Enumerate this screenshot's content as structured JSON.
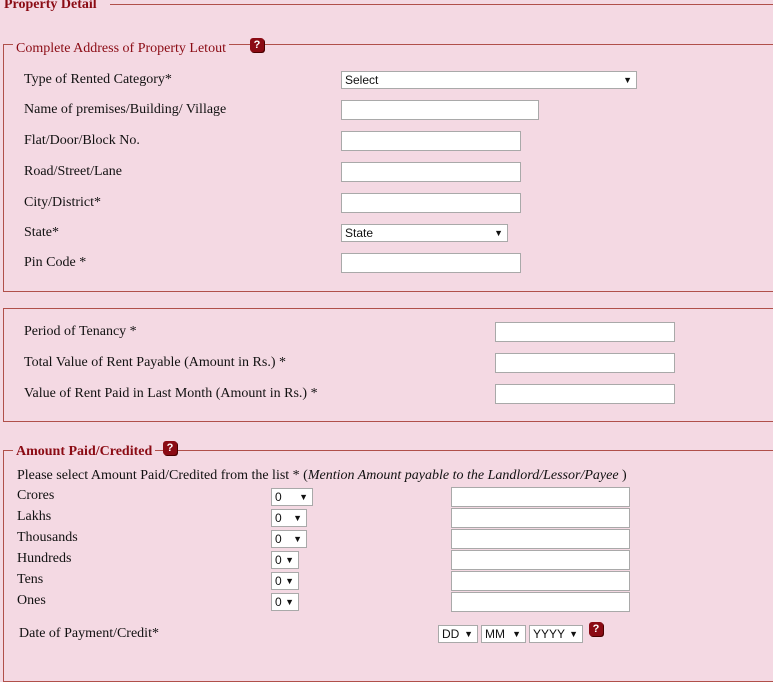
{
  "section_title": "Property Detail",
  "address": {
    "legend": "Complete Address of Property Letout",
    "fields": [
      {
        "label": "Type of Rented Category*",
        "type": "select",
        "value": "Select"
      },
      {
        "label": "Name of premises/Building/ Village",
        "type": "text",
        "value": ""
      },
      {
        "label": "Flat/Door/Block No.",
        "type": "text",
        "value": ""
      },
      {
        "label": "Road/Street/Lane",
        "type": "text",
        "value": ""
      },
      {
        "label": "City/District*",
        "type": "text",
        "value": ""
      },
      {
        "label": "State*",
        "type": "select",
        "value": "State"
      },
      {
        "label": "Pin Code *",
        "type": "text",
        "value": ""
      }
    ]
  },
  "tenancy": {
    "fields": [
      {
        "label": "Period of Tenancy *",
        "value": ""
      },
      {
        "label": "Total Value of Rent Payable (Amount in Rs.) *",
        "value": ""
      },
      {
        "label": "Value of Rent Paid in Last Month (Amount in Rs.) *",
        "value": ""
      }
    ]
  },
  "amount": {
    "legend": "Amount Paid/Credited",
    "instruction_prefix": "Please select Amount Paid/Credited from the list * (",
    "instruction_italic": "Mention Amount payable to the Landlord/Lessor/Payee",
    "instruction_suffix": " )",
    "rows": [
      {
        "label": "Crores",
        "select_value": "0",
        "text_value": ""
      },
      {
        "label": "Lakhs",
        "select_value": "0",
        "text_value": ""
      },
      {
        "label": "Thousands",
        "select_value": "0",
        "text_value": ""
      },
      {
        "label": "Hundreds",
        "select_value": "0",
        "text_value": ""
      },
      {
        "label": "Tens",
        "select_value": "0",
        "text_value": ""
      },
      {
        "label": "Ones",
        "select_value": "0",
        "text_value": ""
      }
    ],
    "date_label": "Date of Payment/Credit*",
    "date_day": "DD",
    "date_month": "MM",
    "date_year": "YYYY"
  },
  "help_glyph": "?",
  "dropdown_arrow": "▼",
  "colors": {
    "background": "#f4d9e3",
    "accent": "#8b0b14",
    "border": "#b0504a"
  }
}
